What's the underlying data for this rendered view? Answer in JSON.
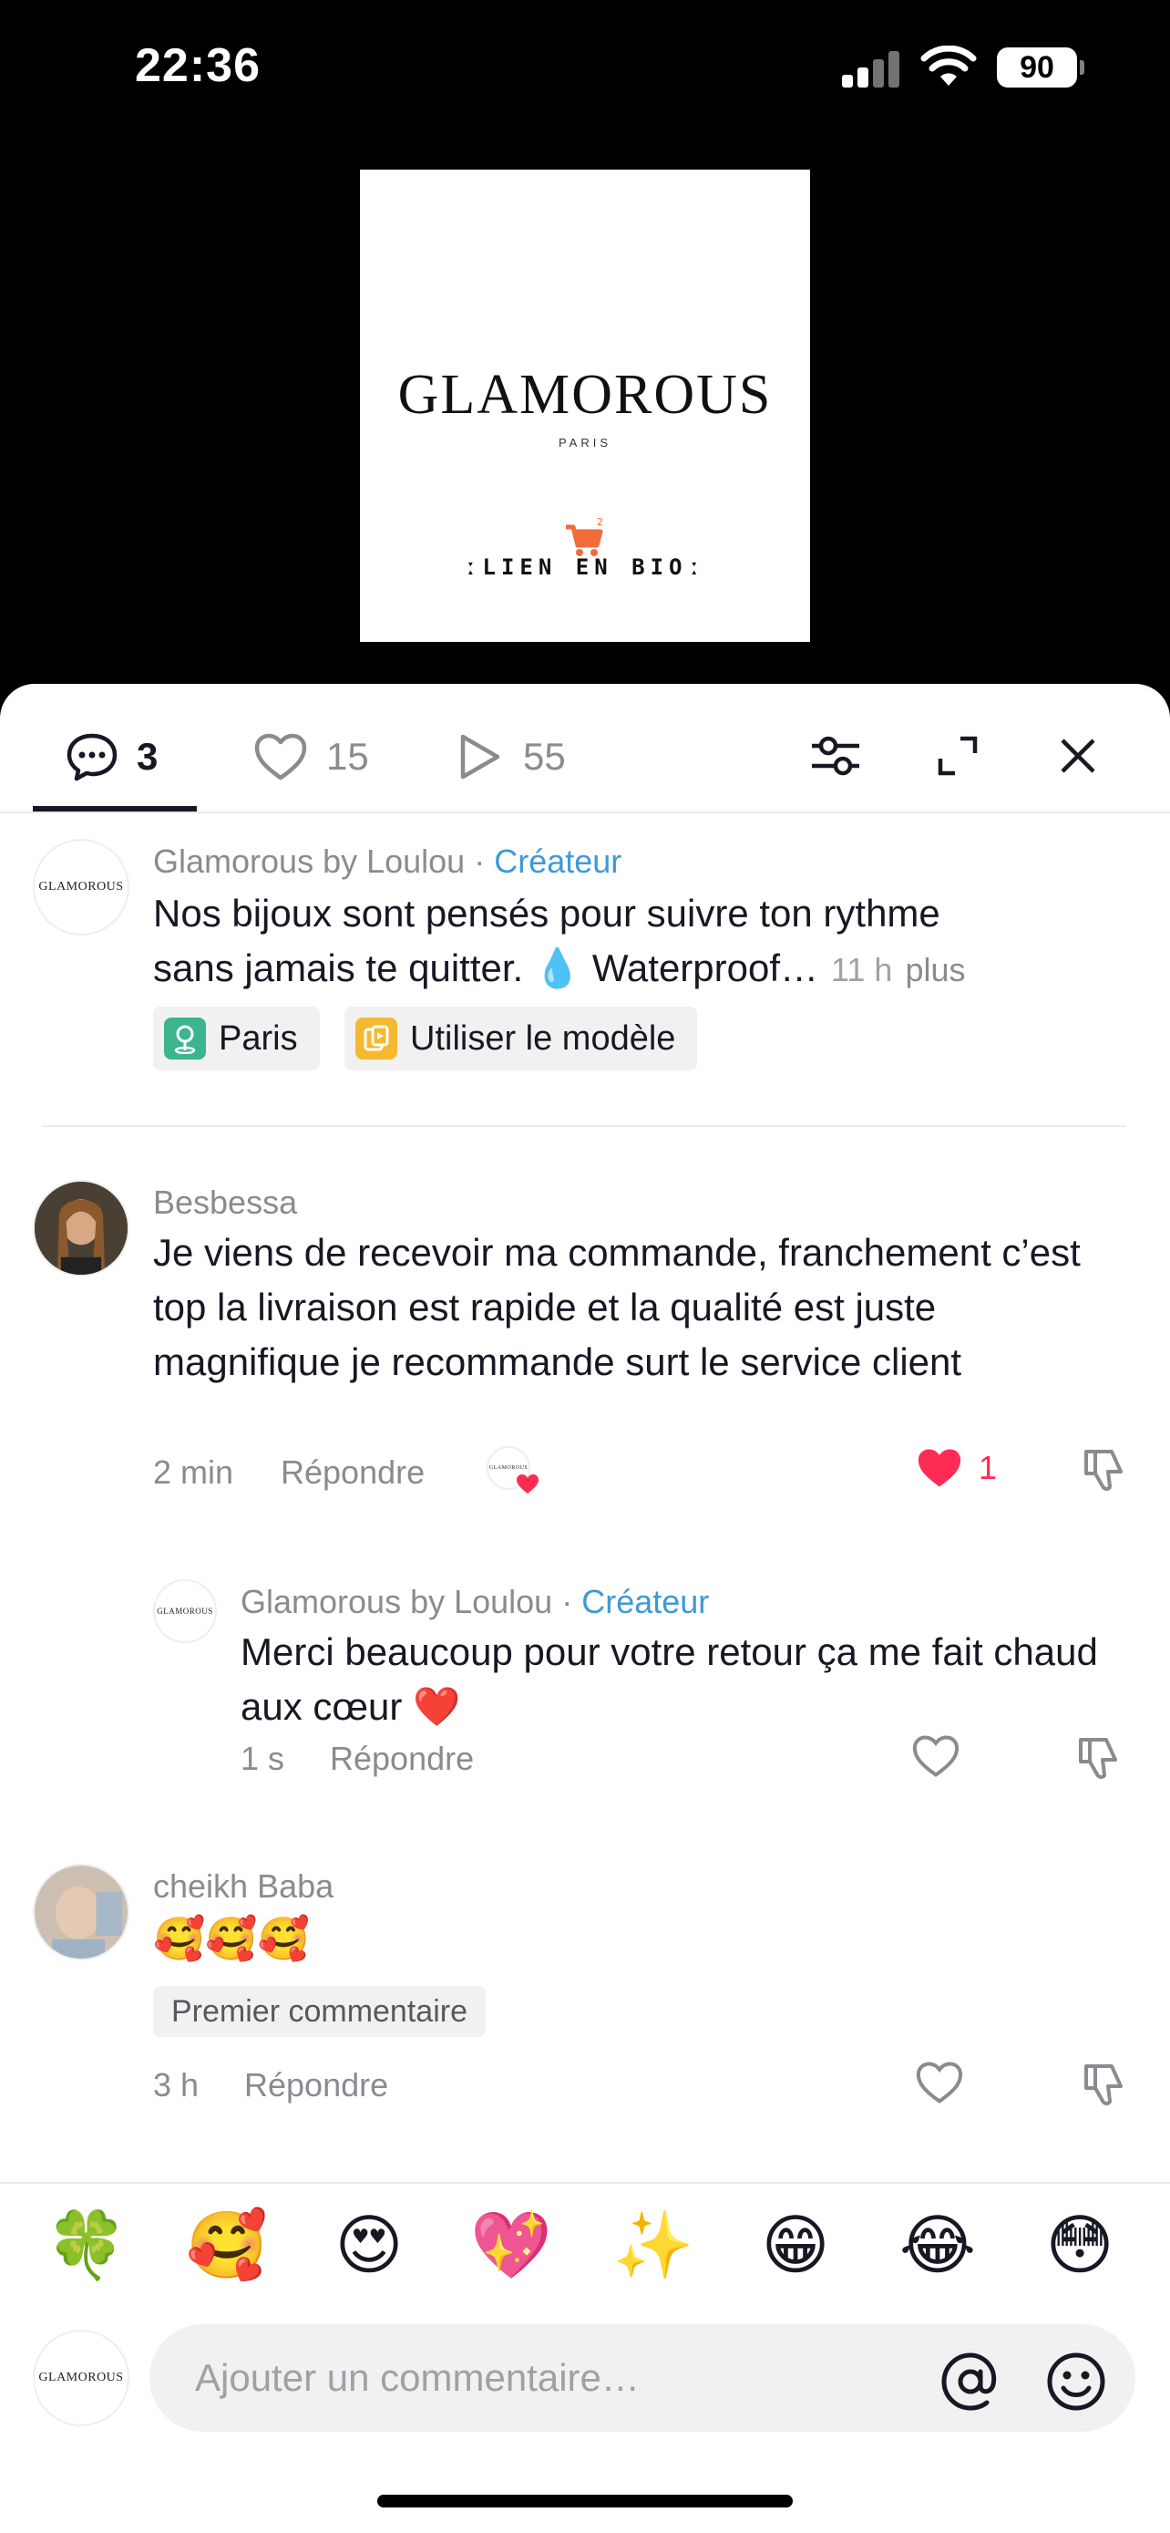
{
  "status_bar": {
    "time": "22:36",
    "battery": "90"
  },
  "video": {
    "brand_name": "GLAMOROUS",
    "brand_sub": "PARIS",
    "cta_text": "ːLIEN EN BIOː"
  },
  "tabs": {
    "comments_count": "3",
    "likes_count": "15",
    "plays_count": "55"
  },
  "caption": {
    "avatar_text": "GLAMOROUS",
    "username": "Glamorous by Loulou",
    "separator": " · ",
    "creator_label": "Créateur",
    "text_line1": "Nos bijoux sont pensés pour suivre ton rythme",
    "text_line2": "sans jamais te quitter. 💧 Waterproof…",
    "time": "11 h",
    "more_label": "plus",
    "chip_location": "Paris",
    "chip_template": "Utiliser le modèle"
  },
  "comments": [
    {
      "username": "Besbessa",
      "text": "Je viens de recevoir ma commande, franchement c’est top la livraison est rapide et la qualité est juste magnifique je recommande surt le service client",
      "time": "2 min",
      "reply_label": "Répondre",
      "like_count": "1",
      "liked_by_creator": true
    },
    {
      "username": "Glamorous by Loulou",
      "separator": " · ",
      "creator_label": "Créateur",
      "avatar_text": "GLAMOROUS",
      "text": "Merci beaucoup pour votre retour ça me fait chaud aux cœur ❤️",
      "time": "1 s",
      "reply_label": "Répondre"
    },
    {
      "username": "cheikh Baba",
      "text": "🥰🥰🥰",
      "badge": "Premier commentaire",
      "time": "3 h",
      "reply_label": "Répondre"
    }
  ],
  "emoji_bar": [
    "🍀",
    "🥰",
    "😍",
    "💖",
    "✨",
    "😁",
    "😂",
    "😳"
  ],
  "input": {
    "placeholder": "Ajouter un commentaire…",
    "avatar_text": "GLAMOROUS"
  }
}
